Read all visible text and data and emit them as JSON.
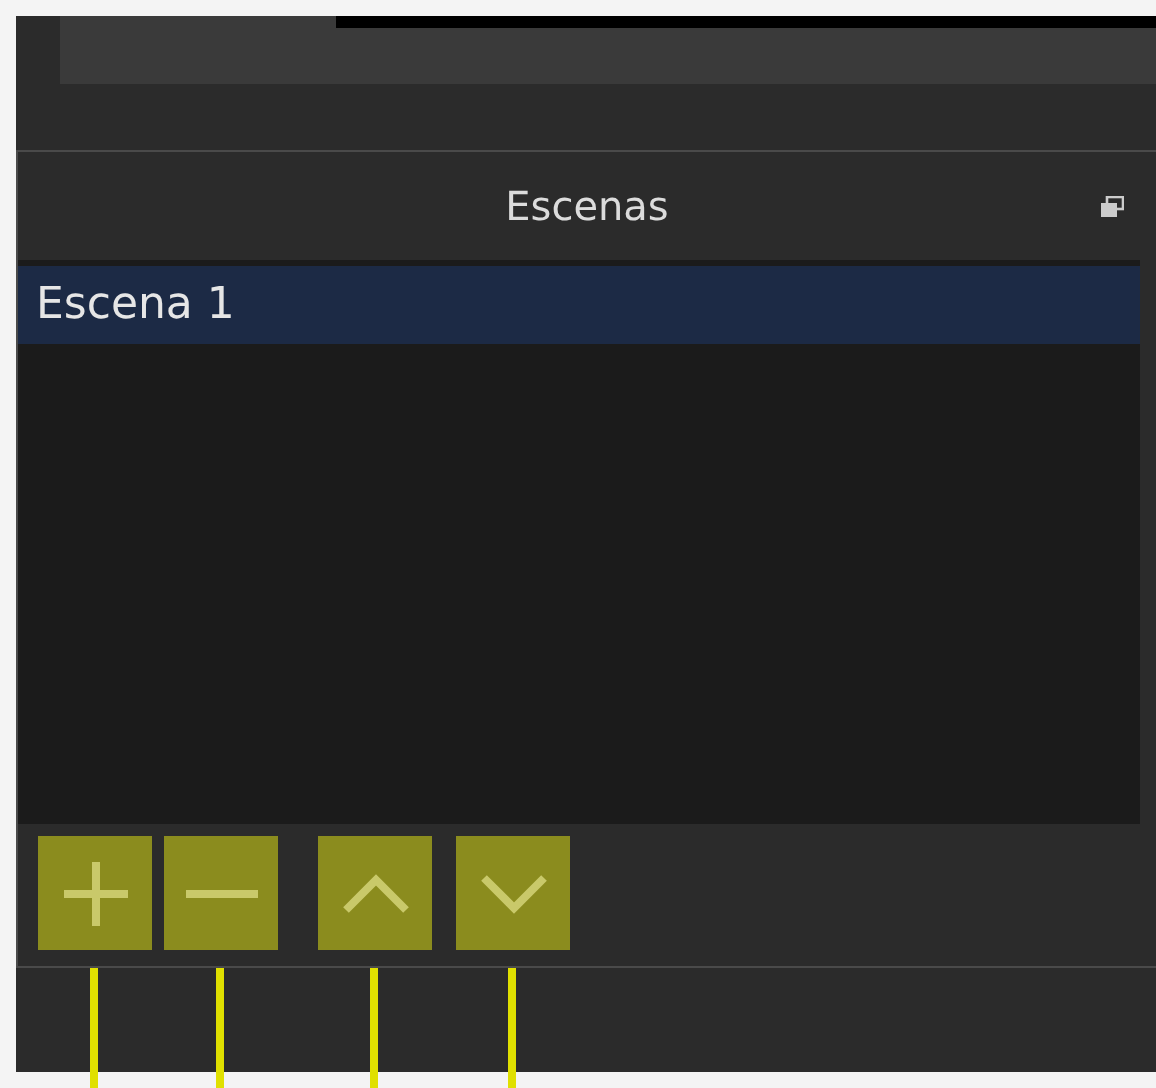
{
  "scenes_panel": {
    "title": "Escenas",
    "items": [
      {
        "label": "Escena 1",
        "selected": true
      }
    ],
    "toolbar": [
      {
        "kind": "add"
      },
      {
        "kind": "remove"
      },
      {
        "kind": "up"
      },
      {
        "kind": "down"
      }
    ]
  }
}
